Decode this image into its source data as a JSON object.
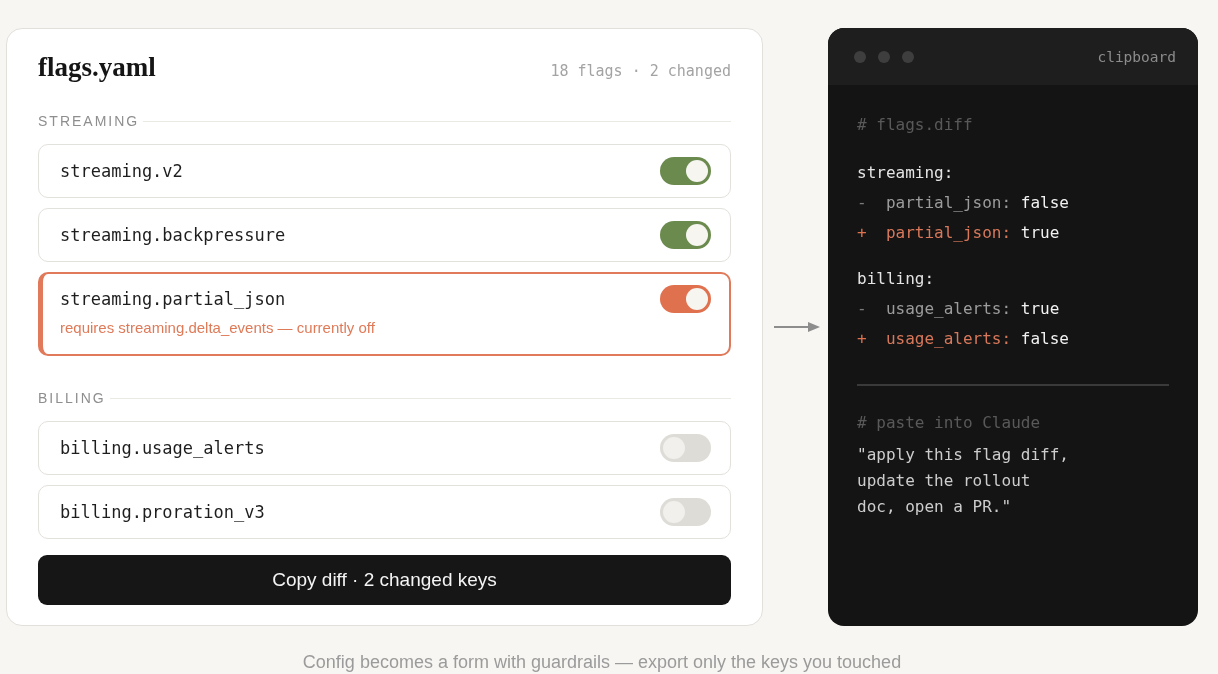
{
  "editor": {
    "title": "flags.yaml",
    "summary": "18 flags · 2 changed",
    "sections": [
      {
        "label": "STREAMING",
        "flags": [
          {
            "key": "streaming.v2",
            "on": true
          },
          {
            "key": "streaming.backpressure",
            "on": true
          },
          {
            "key": "streaming.partial_json",
            "on": true,
            "warning": "requires streaming.delta_events — currently off"
          }
        ]
      },
      {
        "label": "BILLING",
        "flags": [
          {
            "key": "billing.usage_alerts",
            "on": false
          },
          {
            "key": "billing.proration_v3",
            "on": false
          }
        ]
      }
    ],
    "copy_button": "Copy diff · 2 changed keys"
  },
  "clipboard": {
    "title": "clipboard",
    "diff_comment": "# flags.diff",
    "groups": [
      {
        "header": "streaming:",
        "lines": [
          {
            "kind": "removed",
            "sign": "-",
            "key": "partial_json:",
            "value": "false"
          },
          {
            "kind": "added",
            "sign": "+",
            "key": "partial_json:",
            "value": "true"
          }
        ]
      },
      {
        "header": "billing:",
        "lines": [
          {
            "kind": "removed",
            "sign": "-",
            "key": "usage_alerts:",
            "value": "true"
          },
          {
            "kind": "added",
            "sign": "+",
            "key": "usage_alerts:",
            "value": "false"
          }
        ]
      }
    ],
    "prompt_comment": "# paste into Claude",
    "prompt": "\"apply this flag diff,\nupdate the rollout\ndoc, open a PR.\""
  },
  "caption": "Config becomes a form with guardrails — export only the keys you touched"
}
